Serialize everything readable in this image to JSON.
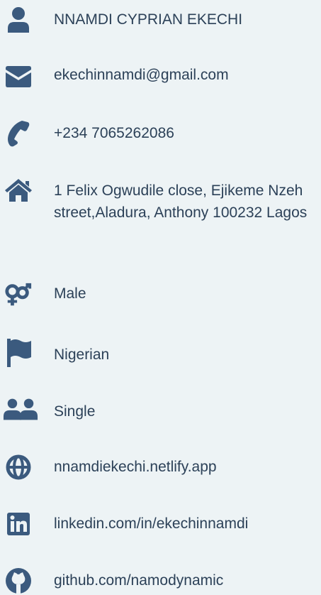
{
  "contact": {
    "name": "NNAMDI CYPRIAN EKECHI",
    "email": "ekechinnamdi@gmail.com",
    "phone": "+234 7065262086",
    "address": "1 Felix Ogwudile close, Ejikeme Nzeh street,Aladura, Anthony 100232 Lagos",
    "gender": "Male",
    "nationality": "Nigerian",
    "marital_status": "Single",
    "website": "nnamdiekechi.netlify.app",
    "linkedin": "linkedin.com/in/ekechinnamdi",
    "github": "github.com/namodynamic"
  },
  "icons": {
    "name": "user-icon",
    "email": "envelope-icon",
    "phone": "phone-icon",
    "address": "home-icon",
    "gender": "gender-icon",
    "nationality": "flag-icon",
    "marital_status": "users-icon",
    "website": "globe-icon",
    "linkedin": "linkedin-icon",
    "github": "github-icon"
  },
  "colors": {
    "background": "#edf3f5",
    "icon": "#3b5a7e",
    "text": "#2c4158"
  }
}
